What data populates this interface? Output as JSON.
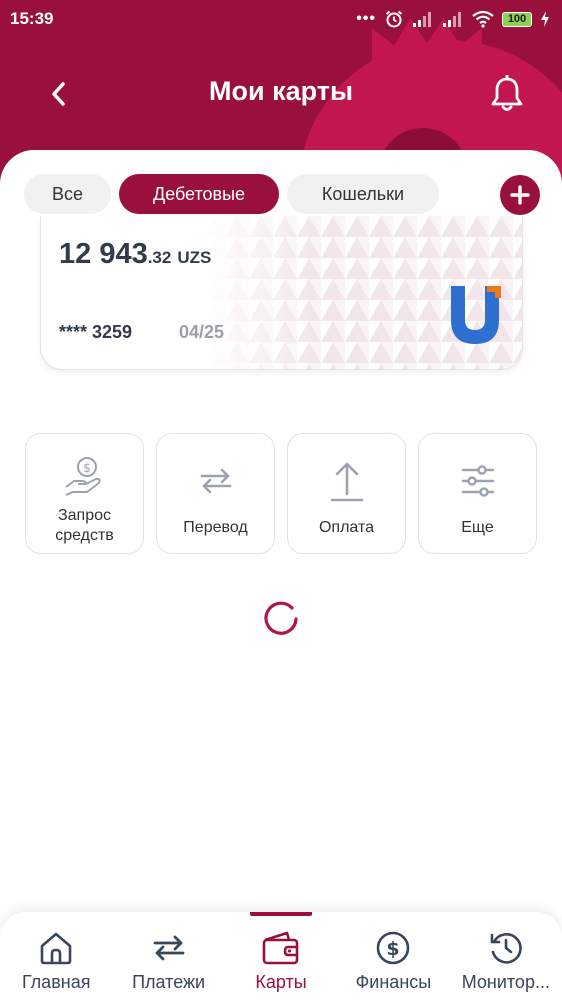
{
  "status_bar": {
    "time": "15:39",
    "dots": "•••",
    "battery": "100",
    "icons": [
      "alarm-icon",
      "signal-icon",
      "signal-icon",
      "wifi-icon",
      "battery-icon",
      "charging-icon"
    ]
  },
  "header": {
    "title": "Мои карты",
    "back_icon": "chevron-left-icon",
    "bell_icon": "bell-icon",
    "colors": {
      "brand": "#99103c",
      "brand_light": "#c2164f"
    }
  },
  "tabs": [
    {
      "label": "Все",
      "active": false
    },
    {
      "label": "Дебетовые",
      "active": true
    },
    {
      "label": "Кошельки",
      "active": false
    }
  ],
  "add_icon": "plus-icon",
  "card": {
    "balance_main": "12 943",
    "balance_cents": ".32",
    "currency": "UZS",
    "number": "**** 3259",
    "expiry": "04/25",
    "logo": "uzcard-logo"
  },
  "actions": [
    {
      "label": "Запрос\nсредств",
      "icon": "hand-coin-icon"
    },
    {
      "label": "Перевод",
      "icon": "transfer-arrows-icon"
    },
    {
      "label": "Оплата",
      "icon": "upload-arrow-icon"
    },
    {
      "label": "Еще",
      "icon": "sliders-icon"
    }
  ],
  "loader_icon": "spinner-icon",
  "bottom_nav": [
    {
      "label": "Главная",
      "icon": "home-icon",
      "active": false
    },
    {
      "label": "Платежи",
      "icon": "transfer-arrows-icon",
      "active": false
    },
    {
      "label": "Карты",
      "icon": "wallet-icon",
      "active": true
    },
    {
      "label": "Финансы",
      "icon": "dollar-circle-icon",
      "active": false
    },
    {
      "label": "Монитор...",
      "icon": "history-icon",
      "active": false
    }
  ]
}
